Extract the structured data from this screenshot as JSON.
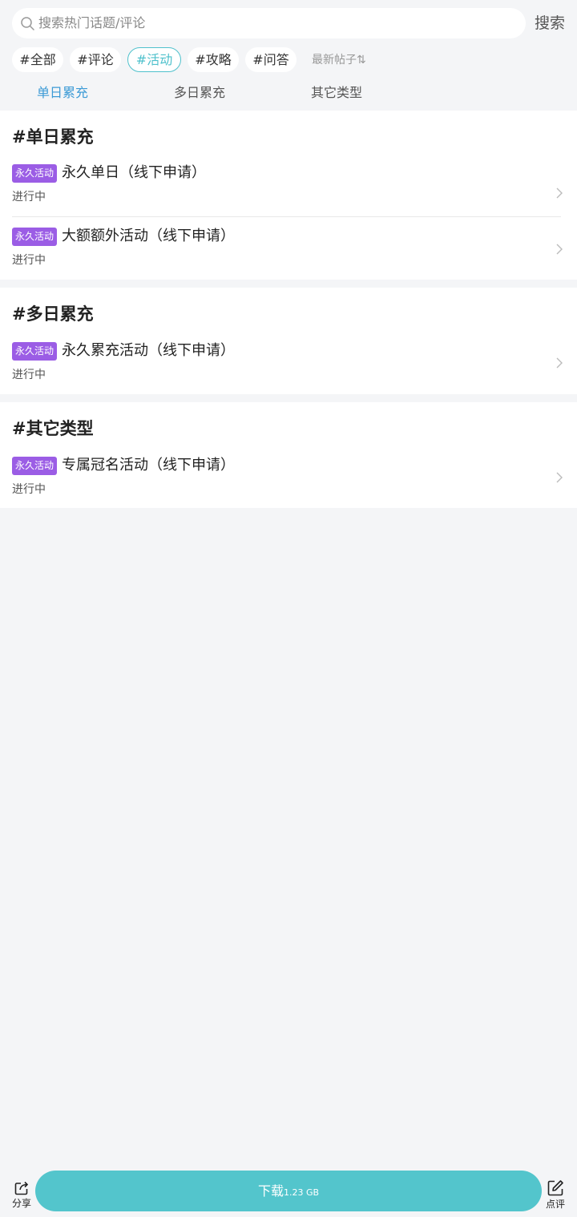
{
  "search": {
    "placeholder": "搜索热门话题/评论",
    "button_label": "搜索"
  },
  "filter_chips": [
    {
      "label": "#全部",
      "active": false
    },
    {
      "label": "#评论",
      "active": false
    },
    {
      "label": "#活动",
      "active": true
    },
    {
      "label": "#攻略",
      "active": false
    },
    {
      "label": "#问答",
      "active": false
    }
  ],
  "sort": {
    "label": "最新帖子⇅"
  },
  "tabs": [
    {
      "label": "单日累充",
      "active": true
    },
    {
      "label": "多日累充",
      "active": false
    },
    {
      "label": "其它类型",
      "active": false
    }
  ],
  "sections": [
    {
      "title": "#单日累充",
      "items": [
        {
          "badge": "永久活动",
          "title": "永久单日（线下申请）",
          "status": "进行中"
        },
        {
          "badge": "永久活动",
          "title": "大额额外活动（线下申请）",
          "status": "进行中"
        }
      ]
    },
    {
      "title": "#多日累充",
      "items": [
        {
          "badge": "永久活动",
          "title": "永久累充活动（线下申请）",
          "status": "进行中"
        }
      ]
    },
    {
      "title": "#其它类型",
      "items": [
        {
          "badge": "永久活动",
          "title": "专属冠名活动（线下申请）",
          "status": "进行中"
        }
      ]
    }
  ],
  "bottom_bar": {
    "share_label": "分享",
    "download_label": "下载",
    "download_size": "1.23 GB",
    "review_label": "点评"
  },
  "colors": {
    "accent": "#4fc1cc",
    "tab_active": "#3d9bd6",
    "badge": "#9b5de5",
    "download_button": "#53c5cc"
  }
}
